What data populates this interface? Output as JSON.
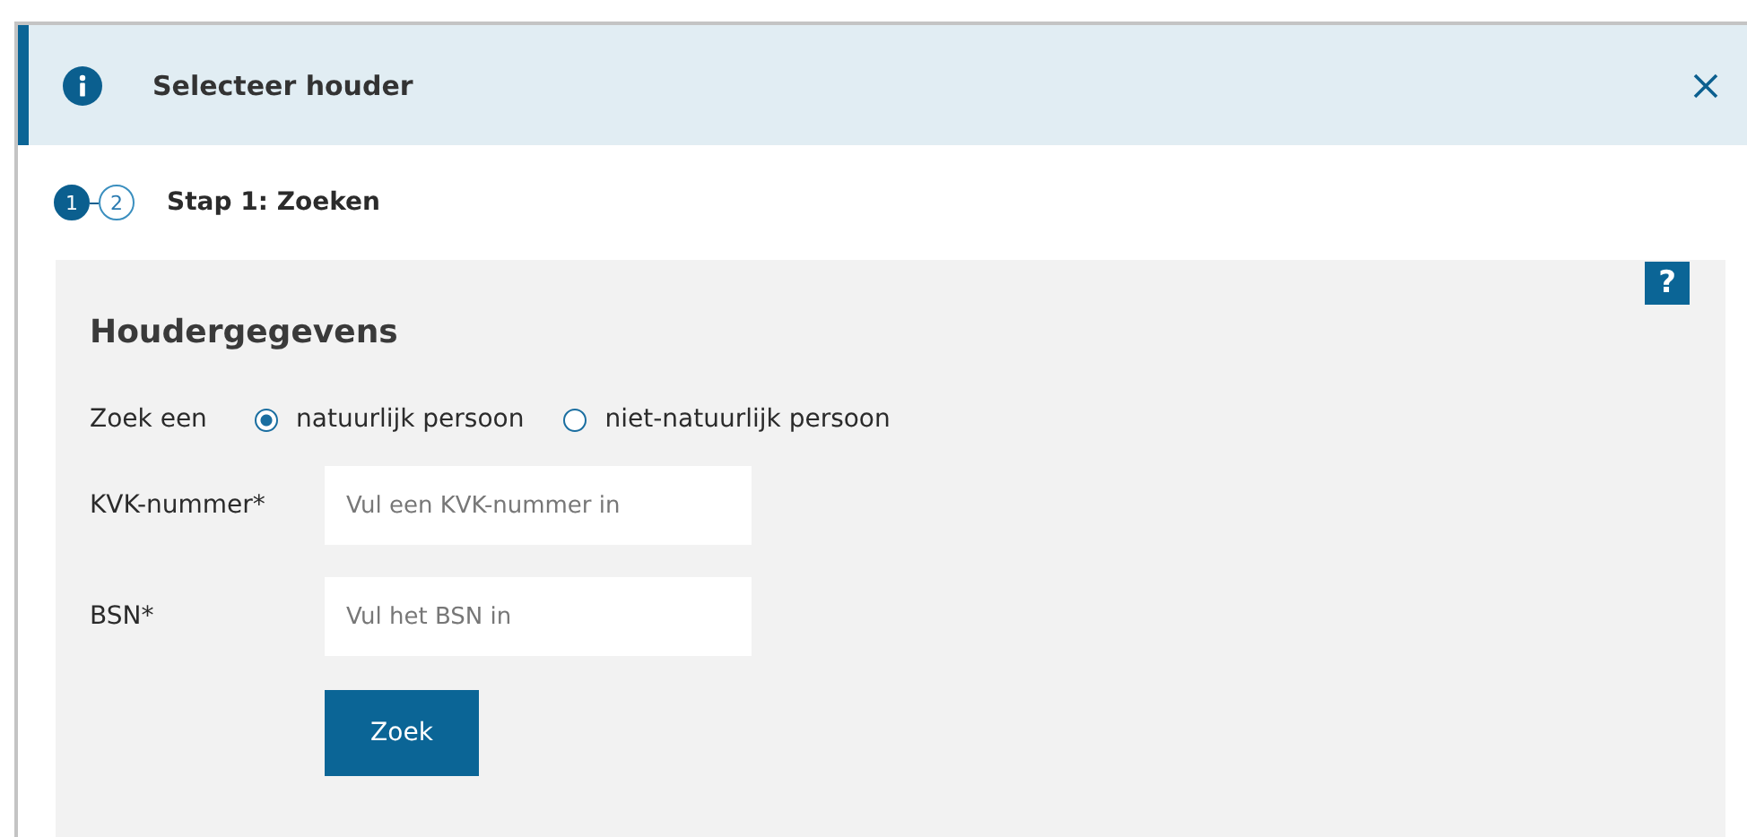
{
  "dialog": {
    "title": "Selecteer houder"
  },
  "steps": [
    {
      "number": "1",
      "selected": true
    },
    {
      "number": "2",
      "selected": false
    }
  ],
  "step_title": "Stap 1: Zoeken",
  "help_button": "?",
  "form": {
    "heading": "Houdergegevens",
    "radio_label": "Zoek een",
    "options": [
      {
        "label": "natuurlijk persoon",
        "selected": true
      },
      {
        "label": "niet-natuurlijk persoon",
        "selected": false
      }
    ],
    "fields": [
      {
        "label": "KVK-nummer*",
        "placeholder": "Vul een KVK-nummer in"
      },
      {
        "label": "BSN*",
        "placeholder": "Vul het BSN in"
      }
    ],
    "submit": "Zoek"
  }
}
